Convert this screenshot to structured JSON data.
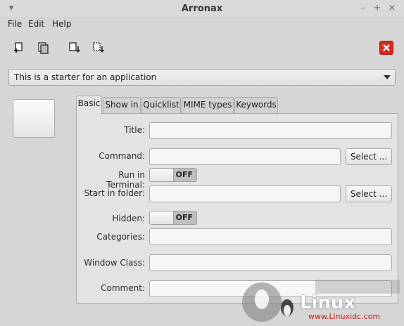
{
  "window": {
    "title": "Arronax"
  },
  "titlebar_buttons": {
    "menu": "▾",
    "minimize": "–",
    "maximize": "+",
    "close": "×"
  },
  "menubar": {
    "items": [
      "File",
      "Edit",
      "Help"
    ]
  },
  "toolbar": {
    "icons": [
      "new-file-icon",
      "open-icon",
      "save-icon",
      "save-as-icon"
    ],
    "close_icon": "red-x-icon",
    "accent": "#d52a20"
  },
  "combo": {
    "value": "This is a starter for an application"
  },
  "tabs": [
    "Basic",
    "Show in",
    "Quicklist",
    "MIME types",
    "Keywords"
  ],
  "form": {
    "title_label": "Title:",
    "command_label": "Command:",
    "select_label": "Select ...",
    "run_terminal_label": "Run in Terminal:",
    "run_terminal_state": "OFF",
    "start_folder_label": "Start in folder:",
    "hidden_label": "Hidden:",
    "hidden_state": "OFF",
    "categories_label": "Categories:",
    "window_class_label": "Window Class:",
    "comment_label": "Comment:"
  },
  "watermark": {
    "site": "Linux",
    "site2": "www.Linuxidc.com"
  }
}
